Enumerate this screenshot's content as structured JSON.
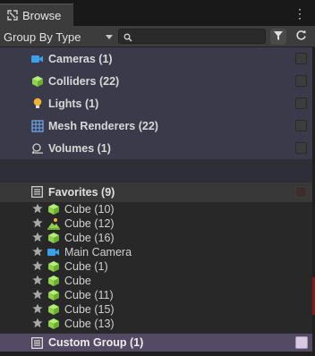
{
  "tab": {
    "title": "Browse",
    "icon": "browse-icon"
  },
  "window_menu": {
    "icon": "kebab-menu-icon",
    "glyph": "⋮"
  },
  "toolbar": {
    "group_by_value": "Group By Type",
    "search_value": "",
    "search_icon": "search-icon",
    "filter_icon": "filter-icon",
    "refresh_icon": "refresh-icon"
  },
  "type_groups": [
    {
      "label": "Cameras (1)",
      "icon": "camera-icon",
      "color": "#3aa0e8"
    },
    {
      "label": "Colliders (22)",
      "icon": "cube-icon",
      "color": "#8fd14f"
    },
    {
      "label": "Lights (1)",
      "icon": "light-bulb-icon",
      "color": "#f2b233"
    },
    {
      "label": "Mesh Renderers (22)",
      "icon": "grid-icon",
      "color": "#6aa8e6"
    },
    {
      "label": "Volumes (1)",
      "icon": "volume-icon",
      "color": "#d0d0d0"
    }
  ],
  "favorites": {
    "label": "Favorites (9)",
    "icon": "list-icon",
    "items": [
      {
        "label": "Cube (10)",
        "icon": "cube-icon"
      },
      {
        "label": "Cube (12)",
        "icon": "terrain-icon"
      },
      {
        "label": "Cube (16)",
        "icon": "cube-icon"
      },
      {
        "label": "Main Camera",
        "icon": "camera-icon"
      },
      {
        "label": "Cube (1)",
        "icon": "cube-icon"
      },
      {
        "label": "Cube",
        "icon": "cube-icon"
      },
      {
        "label": "Cube (11)",
        "icon": "cube-icon"
      },
      {
        "label": "Cube (15)",
        "icon": "cube-icon"
      },
      {
        "label": "Cube (13)",
        "icon": "cube-icon"
      }
    ]
  },
  "custom_group": {
    "label": "Custom Group (1)",
    "icon": "list-icon",
    "color": "#d7c8e3"
  },
  "colors": {
    "row_bg": "#3a3a4a",
    "panel_bg": "#282828",
    "accent_purple": "#544a63",
    "star": "#a8a8a8"
  }
}
